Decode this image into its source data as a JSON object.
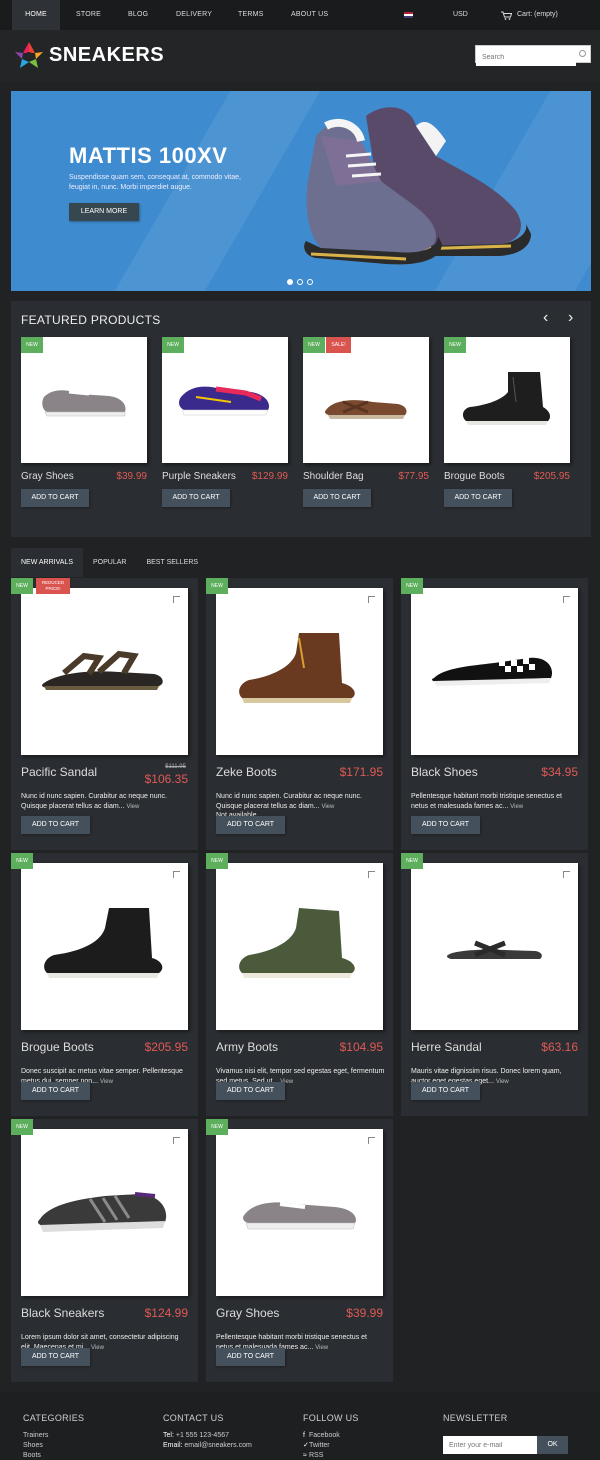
{
  "nav": {
    "items": [
      "HOME",
      "STORE",
      "BLOG",
      "DELIVERY",
      "TERMS",
      "ABOUT US"
    ],
    "currency": "USD",
    "cart": "Cart: (empty)"
  },
  "header": {
    "logo": "SNEAKERS",
    "search_placeholder": "Search"
  },
  "hero": {
    "title": "MATTIS 100XV",
    "text": "Suspendisse quam sem, consequat at, commodo vitae, feugiat in, nunc. Morbi imperdiet augue.",
    "button": "LEARN MORE"
  },
  "featured": {
    "title": "FEATURED PRODUCTS",
    "prev": "‹",
    "next": "›",
    "cart_label": "ADD TO CART",
    "new_label": "NEW",
    "sale_label": "SALE!",
    "products": [
      {
        "name": "Gray Shoes",
        "price": "$39.99"
      },
      {
        "name": "Purple Sneakers",
        "price": "$129.99"
      },
      {
        "name": "Shoulder Bag",
        "price": "$77.95"
      },
      {
        "name": "Brogue Boots",
        "price": "$205.95"
      }
    ]
  },
  "tabs": [
    "NEW ARRIVALS",
    "POPULAR",
    "BEST SELLERS"
  ],
  "grid": {
    "cart_label": "ADD TO CART",
    "new_label": "NEW",
    "reduced_label": "REDUCED PRICE!",
    "view_label": "View",
    "not_available": "Not available",
    "products": [
      {
        "name": "Pacific Sandal",
        "old_price": "$111.95",
        "price": "$106.35",
        "desc": "Nunc id nunc sapien. Curabitur ac neque nunc. Quisque placerat tellus ac diam..."
      },
      {
        "name": "Zeke Boots",
        "price": "$171.95",
        "desc": "Nunc id nunc sapien. Curabitur ac neque nunc. Quisque placerat tellus ac diam..."
      },
      {
        "name": "Black Shoes",
        "price": "$34.95",
        "desc": "Pellentesque habitant morbi tristique senectus et netus et malesuada fames ac..."
      },
      {
        "name": "Brogue Boots",
        "price": "$205.95",
        "desc": "Donec suscipit ac metus vitae semper. Pellentesque metus dui, semper non..."
      },
      {
        "name": "Army Boots",
        "price": "$104.95",
        "desc": "Vivamus nisi elit, tempor sed egestas eget, fermentum sed metus. Sed ut..."
      },
      {
        "name": "Herre Sandal",
        "price": "$63.16",
        "desc": "Mauris vitae dignissim risus. Donec lorem quam, auctor eget egestas eget..."
      },
      {
        "name": "Black Sneakers",
        "price": "$124.99",
        "desc": "Lorem ipsum dolor sit amet, consectetur adipiscing elit. Maecenas et mi..."
      },
      {
        "name": "Gray Shoes",
        "price": "$39.99",
        "desc": "Pellentesque habitant morbi tristique senectus et netus et malesuada fames ac..."
      }
    ]
  },
  "footer": {
    "categories": {
      "title": "CATEGORIES",
      "items": [
        "Trainers",
        "Shoes",
        "Boots"
      ]
    },
    "contact": {
      "title": "CONTACT US",
      "tel_label": "Tel:",
      "tel": "+1 555 123-4567",
      "email_label": "Email:",
      "email": "email@sneakers.com"
    },
    "follow": {
      "title": "FOLLOW US",
      "items": [
        "Facebook",
        "Twitter",
        "RSS"
      ]
    },
    "newsletter": {
      "title": "NEWSLETTER",
      "placeholder": "Enter your e-mail",
      "button": "OK"
    }
  },
  "colors": {
    "accent_price": "#e05a55",
    "badge_new": "#5daf5d",
    "badge_sale": "#d9534f",
    "hero_bg": "#3e8bcf",
    "button": "#44505c"
  }
}
